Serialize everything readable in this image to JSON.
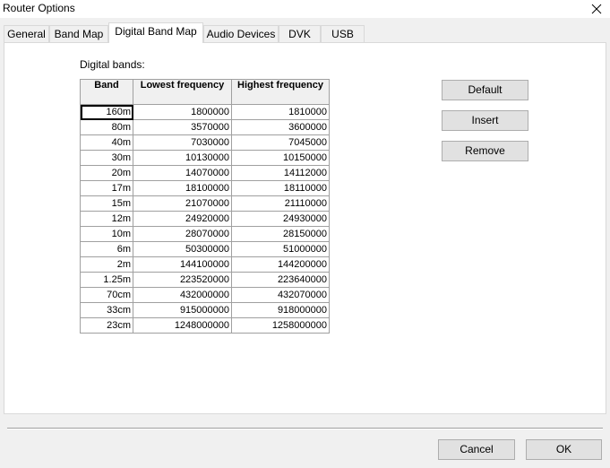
{
  "window": {
    "title": "Router Options"
  },
  "tabs": [
    "General",
    "Band Map",
    "Digital Band Map",
    "Audio Devices",
    "DVK",
    "USB"
  ],
  "active_tab": "Digital Band Map",
  "section_label": "Digital bands:",
  "table": {
    "headers": [
      "Band",
      "Lowest frequency",
      "Highest frequency"
    ],
    "rows": [
      [
        "160m",
        "1800000",
        "1810000"
      ],
      [
        "80m",
        "3570000",
        "3600000"
      ],
      [
        "40m",
        "7030000",
        "7045000"
      ],
      [
        "30m",
        "10130000",
        "10150000"
      ],
      [
        "20m",
        "14070000",
        "14112000"
      ],
      [
        "17m",
        "18100000",
        "18110000"
      ],
      [
        "15m",
        "21070000",
        "21110000"
      ],
      [
        "12m",
        "24920000",
        "24930000"
      ],
      [
        "10m",
        "28070000",
        "28150000"
      ],
      [
        "6m",
        "50300000",
        "51000000"
      ],
      [
        "2m",
        "144100000",
        "144200000"
      ],
      [
        "1.25m",
        "223520000",
        "223640000"
      ],
      [
        "70cm",
        "432000000",
        "432070000"
      ],
      [
        "33cm",
        "915000000",
        "918000000"
      ],
      [
        "23cm",
        "1248000000",
        "1258000000"
      ]
    ]
  },
  "side_buttons": {
    "default": "Default",
    "insert": "Insert",
    "remove": "Remove"
  },
  "footer_buttons": {
    "cancel": "Cancel",
    "ok": "OK"
  }
}
